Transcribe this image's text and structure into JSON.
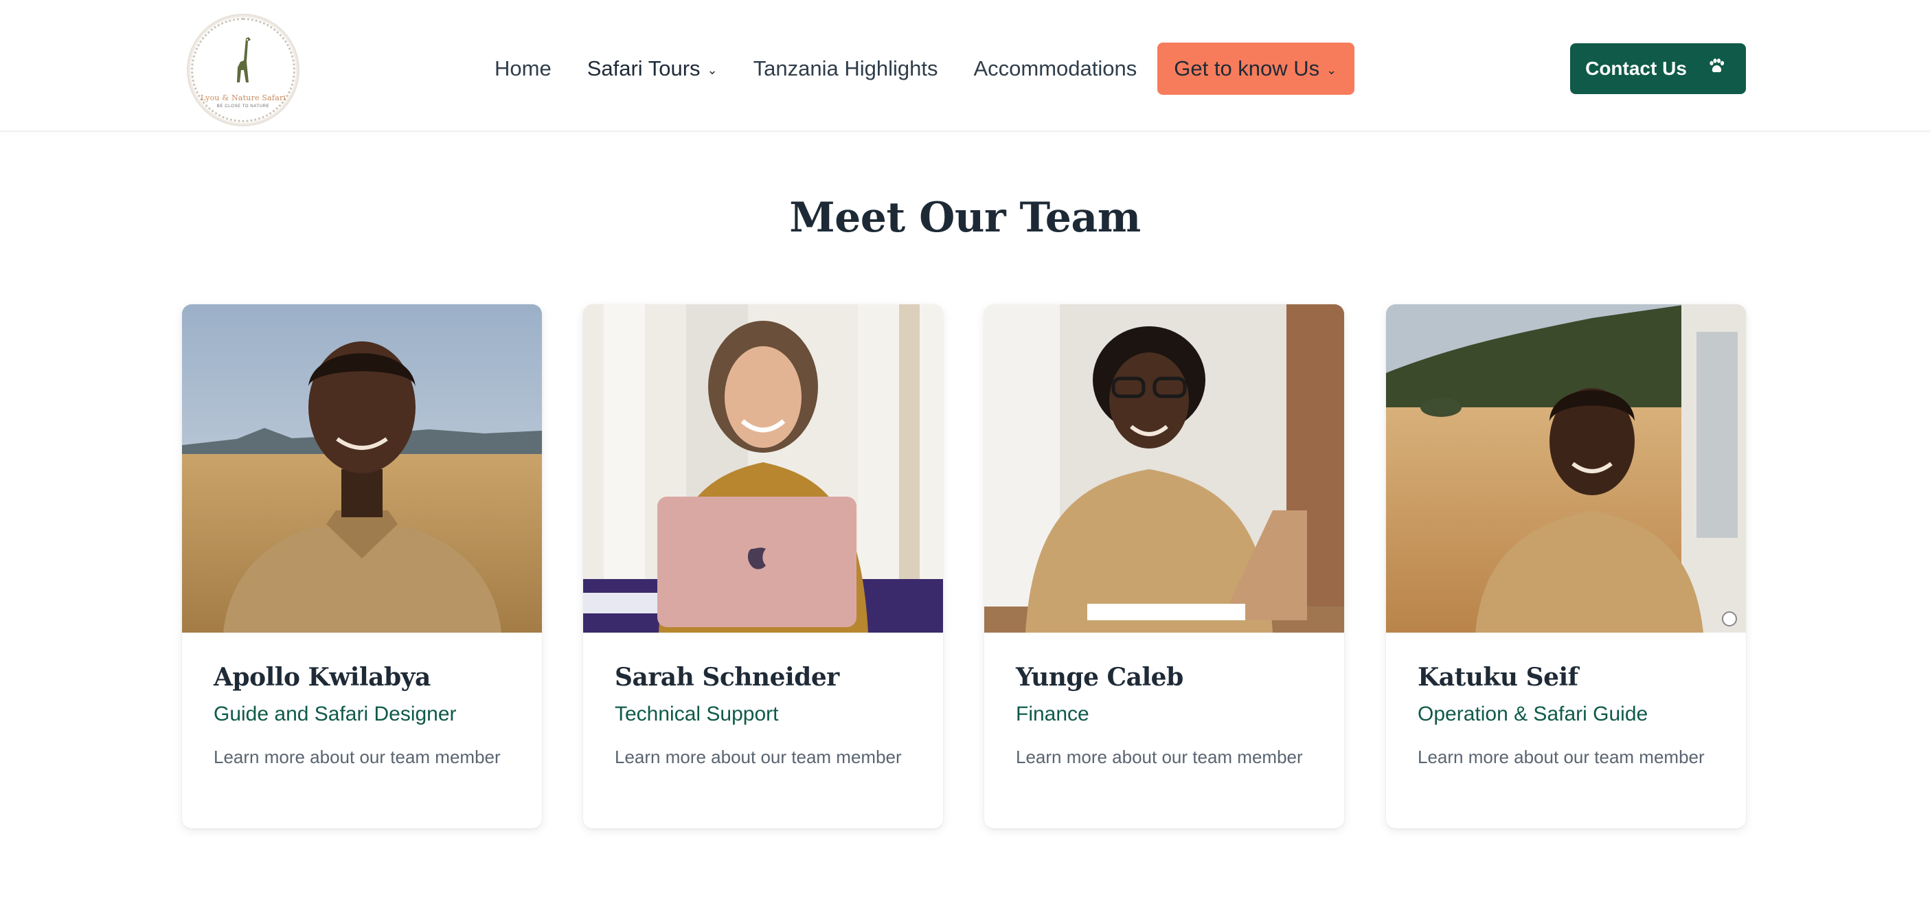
{
  "brand": {
    "logo_text": "Lyou & Nature Safari",
    "logo_subtext": "BE CLOSE TO NATURE"
  },
  "nav": {
    "items": [
      {
        "label": "Home",
        "has_dropdown": false
      },
      {
        "label": "Safari Tours",
        "has_dropdown": true
      },
      {
        "label": "Tanzania Highlights",
        "has_dropdown": false
      },
      {
        "label": "Accommodations",
        "has_dropdown": false
      }
    ],
    "cta": {
      "label": "Get to know Us",
      "has_dropdown": true,
      "color": "#f77c5b"
    },
    "contact": {
      "label": "Contact Us",
      "icon": "paw-icon",
      "color": "#0f5a48"
    }
  },
  "section": {
    "title": "Meet Our Team"
  },
  "team": [
    {
      "name": "Apollo Kwilabya",
      "role": "Guide and Safari Designer",
      "description": "Learn more about our team member"
    },
    {
      "name": "Sarah Schneider",
      "role": "Technical Support",
      "description": "Learn more about our team member"
    },
    {
      "name": "Yunge Caleb",
      "role": "Finance",
      "description": "Learn more about our team member"
    },
    {
      "name": "Katuku Seif",
      "role": "Operation & Safari Guide",
      "description": "Learn more about our team member"
    }
  ],
  "colors": {
    "accent_green": "#0f5a48",
    "accent_coral": "#f77c5b",
    "text_dark": "#1f2a37"
  }
}
